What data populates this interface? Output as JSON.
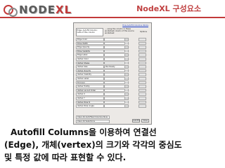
{
  "header": {
    "logo_prefix": "NODE",
    "logo_x": "XL",
    "slide_title": "NodeXL 구성요소",
    "accent": "#c23a3a"
  },
  "dialog": {
    "link": "How AutoFill Columns Works",
    "source_header": "Edge, AutoFill Column: Cells of\nthis column",
    "mapping_header": "... using the column in these\nworksheet column of the source\nworksheet",
    "options_header": "Options",
    "rows": [
      {
        "label": "Edge Color",
        "value": ""
      },
      {
        "label": "Edge Width",
        "value": ""
      },
      {
        "label": "Edge Opacity",
        "value": ""
      },
      {
        "label": "Edge Visibility",
        "value": ""
      },
      {
        "label": "Edge Label",
        "value": ""
      },
      {
        "label": "Vertex Color",
        "value": ""
      },
      {
        "label": "Vertex Shape",
        "value": ""
      },
      {
        "label": "Vertex Size",
        "value": "Pen Ready"
      },
      {
        "label": "Vertex Opacity",
        "value": ""
      },
      {
        "label": "Vertex Visibility",
        "value": ""
      },
      {
        "label": "Vertex Label",
        "value": ""
      },
      {
        "label": "Fill Color",
        "value": ""
      },
      {
        "label": "Vertex Tooltip",
        "value": ""
      },
      {
        "label": "Vertex Layout Order",
        "value": ""
      },
      {
        "label": "Vertex X",
        "value": ""
      },
      {
        "label": "Vertex Y",
        "value": ""
      },
      {
        "label": "Vertex Polar R",
        "value": ""
      },
      {
        "label": "Vertex Polar Angle",
        "value": ""
      }
    ],
    "footer_1": "Clear All AutoFilled Columns Now",
    "footer_2": "Clear All Selections",
    "ok": "AutoFill",
    "cancel": "Close"
  },
  "caption": {
    "line1": "Autofill Columns을 이용하여 연결선",
    "line2": "(Edge), 개체(vertex)의 크기와 각각의 중심도",
    "line3": "및 특정 값에 따라 표현할 수 있다."
  }
}
